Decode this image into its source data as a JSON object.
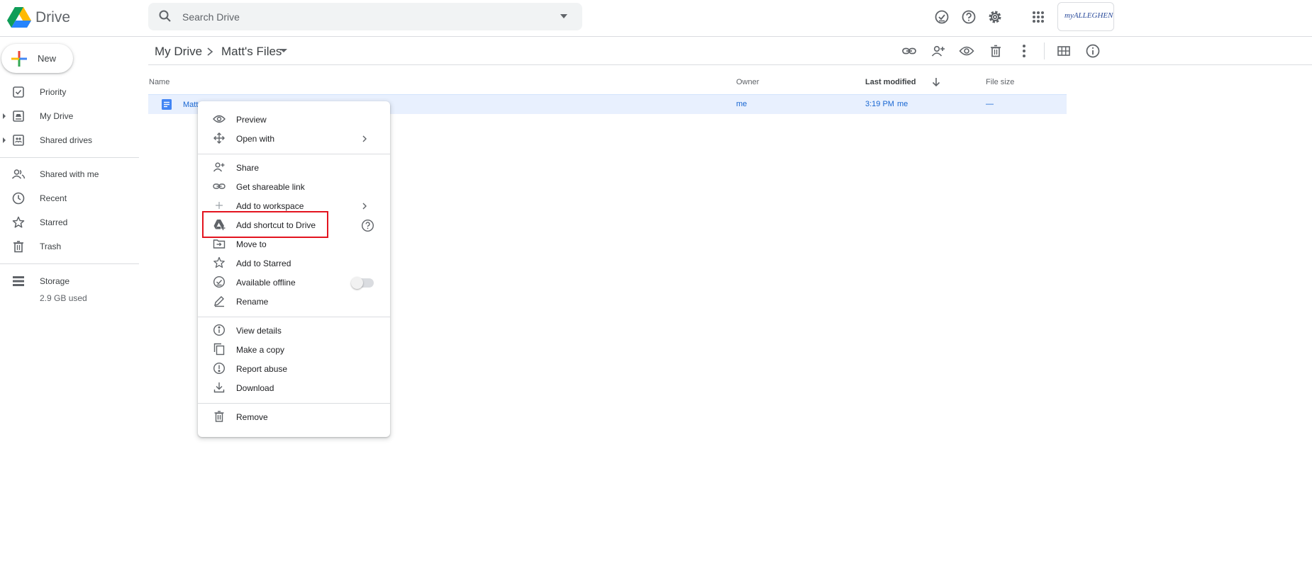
{
  "app": {
    "name": "Drive"
  },
  "search": {
    "placeholder": "Search Drive"
  },
  "account": {
    "logo_text": "myALLEGHENY"
  },
  "new_button": {
    "label": "New"
  },
  "sidebar": {
    "items": [
      {
        "label": "Priority",
        "icon": "priority-icon"
      },
      {
        "label": "My Drive",
        "icon": "my-drive-icon"
      },
      {
        "label": "Shared drives",
        "icon": "shared-drives-icon"
      },
      {
        "label": "Shared with me",
        "icon": "shared-with-me-icon"
      },
      {
        "label": "Recent",
        "icon": "clock-icon"
      },
      {
        "label": "Starred",
        "icon": "star-icon"
      },
      {
        "label": "Trash",
        "icon": "trash-icon"
      }
    ],
    "storage": {
      "label": "Storage",
      "used": "2.9 GB used"
    }
  },
  "breadcrumb": {
    "root": "My Drive",
    "current": "Matt's Files"
  },
  "file_list": {
    "columns": {
      "name": "Name",
      "owner": "Owner",
      "last_modified": "Last modified",
      "file_size": "File size"
    },
    "rows": [
      {
        "name": "Matt",
        "owner": "me",
        "modified_time": "3:19 PM",
        "modified_by": "me",
        "size": "—"
      }
    ]
  },
  "context_menu": {
    "items": [
      {
        "label": "Preview",
        "icon": "eye-icon"
      },
      {
        "label": "Open with",
        "icon": "open-with-icon",
        "submenu": true
      },
      {
        "label": "Share",
        "icon": "share-person-icon"
      },
      {
        "label": "Get shareable link",
        "icon": "link-icon"
      },
      {
        "label": "Add to workspace",
        "icon": "plus-icon",
        "submenu": true
      },
      {
        "label": "Add shortcut to Drive",
        "icon": "drive-shortcut-icon",
        "highlighted": true
      },
      {
        "label": "Move to",
        "icon": "move-to-icon"
      },
      {
        "label": "Add to Starred",
        "icon": "star-icon"
      },
      {
        "label": "Available offline",
        "icon": "offline-check-icon",
        "toggle": false
      },
      {
        "label": "Rename",
        "icon": "pencil-icon"
      },
      {
        "label": "View details",
        "icon": "info-icon"
      },
      {
        "label": "Make a copy",
        "icon": "copy-icon"
      },
      {
        "label": "Report abuse",
        "icon": "report-icon"
      },
      {
        "label": "Download",
        "icon": "download-icon"
      },
      {
        "label": "Remove",
        "icon": "trash-icon"
      }
    ]
  },
  "colors": {
    "selection_bg": "#e8f0fe",
    "link_blue": "#1967d2",
    "highlight_red": "#e3141f",
    "icon_gray": "#5f6368"
  }
}
